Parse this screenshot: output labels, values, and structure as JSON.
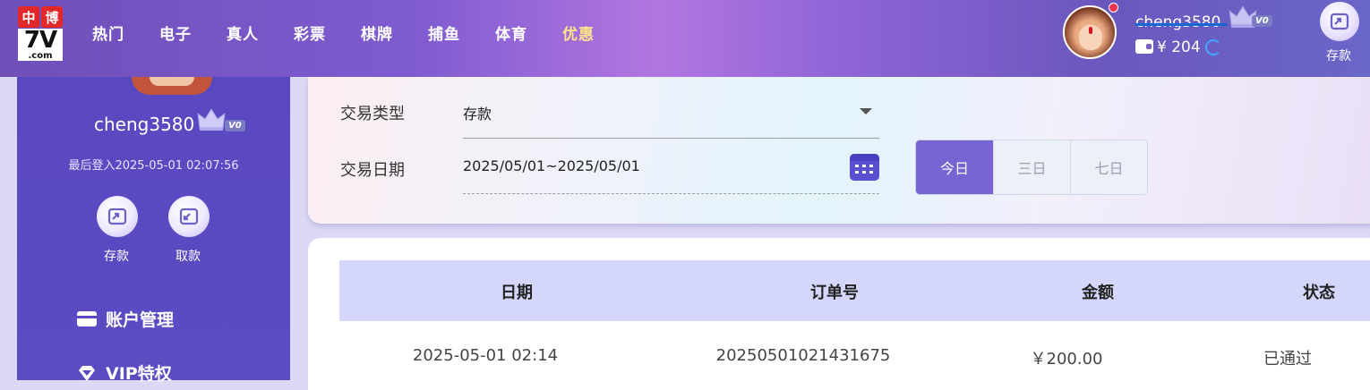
{
  "logo": {
    "char1": "中",
    "char2": "博",
    "main": "7V",
    "suffix": ".com"
  },
  "nav": [
    {
      "label": "热门",
      "active": false
    },
    {
      "label": "电子",
      "active": false
    },
    {
      "label": "真人",
      "active": false
    },
    {
      "label": "彩票",
      "active": false
    },
    {
      "label": "棋牌",
      "active": false
    },
    {
      "label": "捕鱼",
      "active": false
    },
    {
      "label": "体育",
      "active": false
    },
    {
      "label": "优惠",
      "active": true
    }
  ],
  "header_user": {
    "username": "cheng3580",
    "level": "V0",
    "balance": "¥ 204",
    "deposit_label": "存款"
  },
  "sidebar": {
    "username": "cheng3580",
    "level": "V0",
    "last_login": "最后登入2025-05-01 02:07:56",
    "deposit_label": "存款",
    "withdraw_label": "取款",
    "menu": [
      {
        "label": "账户管理",
        "icon": "card-icon"
      },
      {
        "label": "VIP特权",
        "icon": "diamond-icon"
      }
    ]
  },
  "filter": {
    "type_label": "交易类型",
    "type_value": "存款",
    "date_label": "交易日期",
    "date_value": "2025/05/01~2025/05/01",
    "ranges": [
      "今日",
      "三日",
      "七日"
    ],
    "active_range": "今日"
  },
  "table": {
    "columns": [
      "日期",
      "订单号",
      "金额",
      "状态"
    ],
    "rows": [
      [
        "2025-05-01 02:14",
        "20250501021431675",
        "￥200.00",
        "已通过"
      ]
    ]
  },
  "colors": {
    "accent": "#7665d2",
    "sidebar": "#5a48c0",
    "nav_active": "#ffe38a",
    "table_header": "#d4d6fb"
  }
}
